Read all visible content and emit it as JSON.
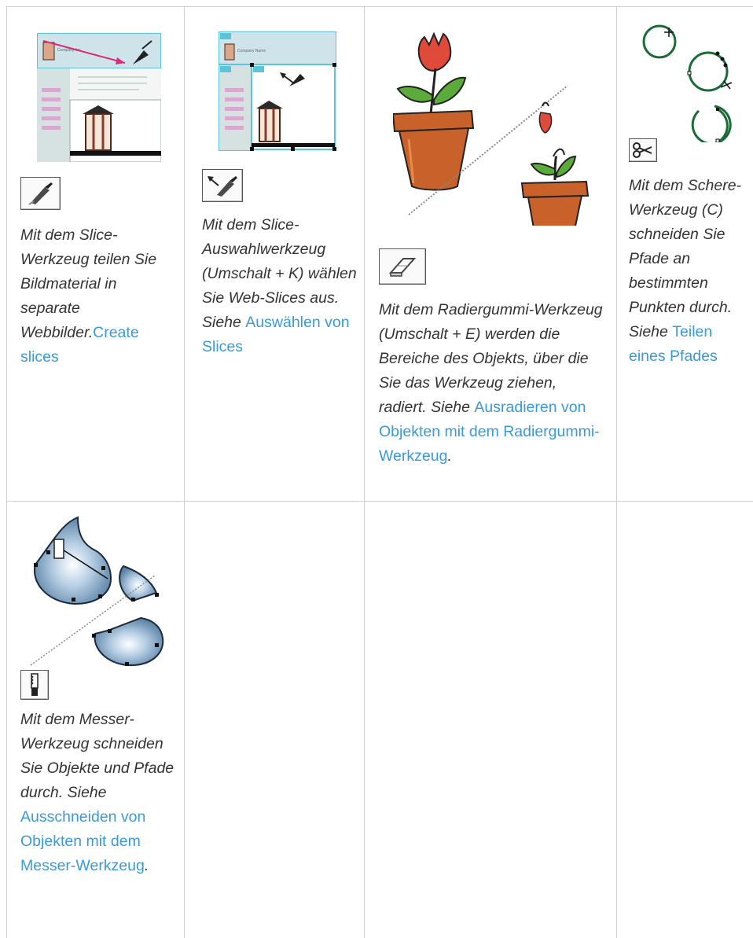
{
  "cells": [
    {
      "icon": "slice-tool-icon",
      "illustration": "slice-tool-illustration",
      "illustration_label": "Company Inc.",
      "text": "Mit dem Slice-Werkzeug teilen Sie Bildmaterial in separate Webbilder.",
      "link": "Create slices",
      "after": ""
    },
    {
      "icon": "slice-select-tool-icon",
      "illustration": "slice-select-illustration",
      "illustration_label": "Company Name",
      "text": "Mit dem Slice-Auswahlwerkzeug (Umschalt + K) wählen Sie Web-Slices aus. Siehe ",
      "link": "Auswählen von Slices",
      "after": ""
    },
    {
      "icon": "eraser-tool-icon",
      "illustration": "eraser-tulip-illustration",
      "text": "Mit dem Radiergummi-Werkzeug (Umschalt + E) werden die Bereiche des Objekts, über die Sie das Werkzeug ziehen, radiert. Siehe ",
      "link": "Ausradieren von Objekten mit dem Radiergummi-Werkzeug",
      "after": "."
    },
    {
      "icon": "scissors-tool-icon",
      "illustration": "scissors-circles-illustration",
      "text": "Mit dem Schere-Werkzeug (C) schneiden Sie Pfade an bestimmten Punkten durch. Siehe ",
      "link": "Teilen eines Pfades",
      "after": ""
    },
    {
      "icon": "knife-tool-icon",
      "illustration": "knife-drop-illustration",
      "text": "Mit dem Messer-Werkzeug schneiden Sie Objekte und Pfade durch. Siehe ",
      "link": "Ausschneiden von Objekten mit dem Messer-Werkzeug",
      "after": "."
    }
  ],
  "colors": {
    "link": "#3a9ad9",
    "text": "#333333",
    "grid": "#cfcfcf"
  }
}
